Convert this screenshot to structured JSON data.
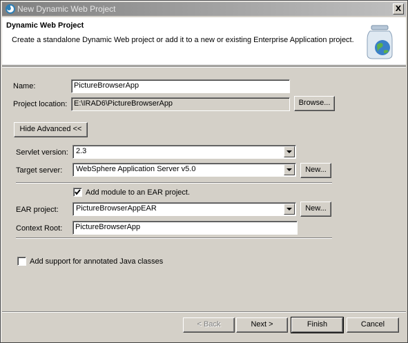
{
  "window": {
    "title": "New Dynamic Web Project",
    "close_label": "X"
  },
  "header": {
    "title": "Dynamic Web Project",
    "description": "Create a standalone Dynamic Web project or add it to a new or existing Enterprise Application project."
  },
  "form": {
    "name_label": "Name:",
    "name_value": "PictureBrowserApp",
    "location_label": "Project location:",
    "location_value": "E:\\IRAD6\\PictureBrowserApp",
    "browse_label": "Browse...",
    "advanced_label": "Hide Advanced <<",
    "servlet_label": "Servlet version:",
    "servlet_value": "2.3",
    "target_label": "Target server:",
    "target_value": "WebSphere Application Server v5.0",
    "target_new_label": "New...",
    "ear_checkbox_label": "Add module to an EAR project.",
    "ear_checkbox_checked": true,
    "ear_label": "EAR project:",
    "ear_value": "PictureBrowserAppEAR",
    "ear_new_label": "New...",
    "context_label": "Context Root:",
    "context_value": "PictureBrowserApp",
    "annotated_label": "Add support for annotated Java classes",
    "annotated_checked": false
  },
  "footer": {
    "back_label": "< Back",
    "next_label": "Next >",
    "finish_label": "Finish",
    "cancel_label": "Cancel"
  }
}
